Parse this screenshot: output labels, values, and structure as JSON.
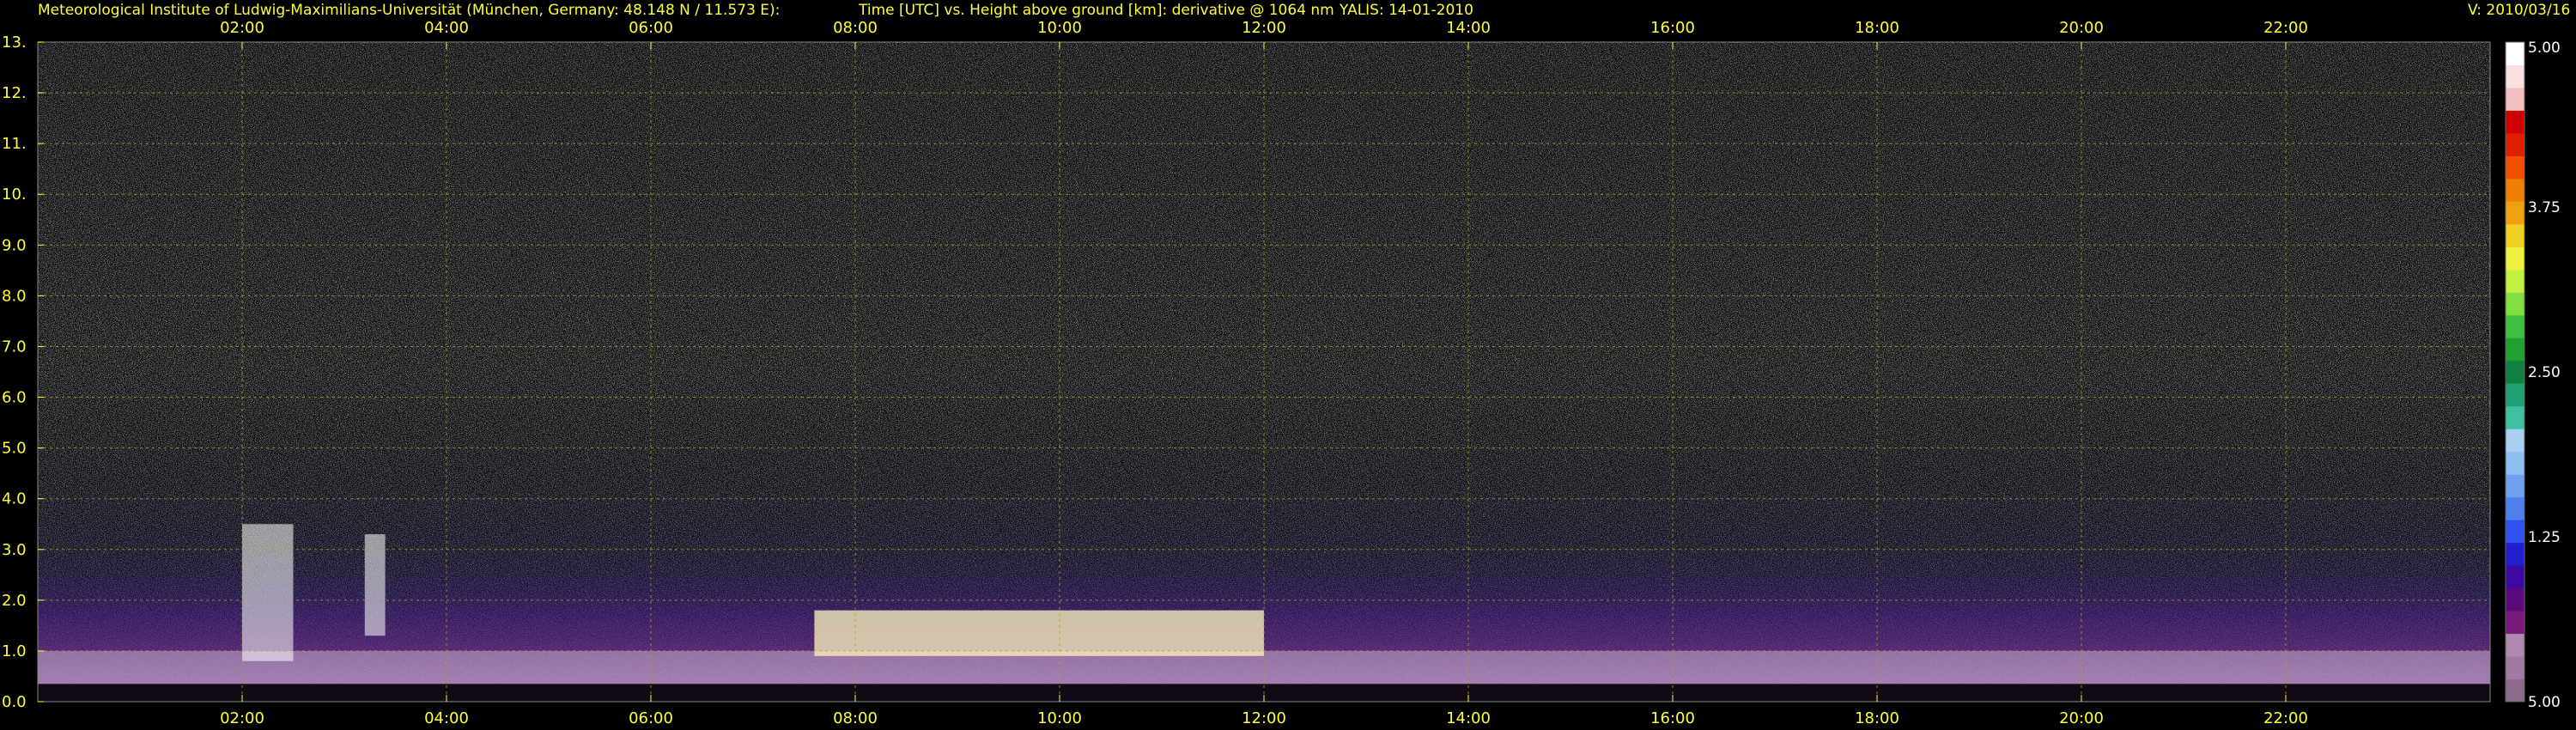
{
  "header": {
    "institute": "Meteorological Institute of Ludwig-Maximilians-Universität (München, Germany: 48.148 N / 11.573 E):",
    "plot_title": "Time [UTC] vs. Height above ground [km]: derivative @ 1064 nm",
    "instrument_date": "YALIS: 14-01-2010",
    "version": "V: 2010/03/16"
  },
  "chart_data": {
    "type": "heatmap",
    "title": "Time [UTC] vs. Height above ground [km]: derivative @ 1064 nm",
    "x_ticks": [
      "02:00",
      "04:00",
      "06:00",
      "08:00",
      "10:00",
      "12:00",
      "14:00",
      "16:00",
      "18:00",
      "20:00",
      "22:00"
    ],
    "x_tick_hours": [
      2,
      4,
      6,
      8,
      10,
      12,
      14,
      16,
      18,
      20,
      22
    ],
    "xlim_hours": [
      0,
      24
    ],
    "y_ticks": [
      "0.0",
      "1.0",
      "2.0",
      "3.0",
      "4.0",
      "5.0",
      "6.0",
      "7.0",
      "8.0",
      "9.0",
      "10.",
      "11.",
      "12.",
      "13."
    ],
    "y_tick_values": [
      0,
      1,
      2,
      3,
      4,
      5,
      6,
      7,
      8,
      9,
      10,
      11,
      12,
      13
    ],
    "ylim_km": [
      0,
      13
    ],
    "grid": true,
    "colorbar": {
      "tick_labels": [
        "5.00",
        "3.75",
        "2.50",
        "1.25",
        "5.00"
      ],
      "tick_values": [
        5.0,
        3.75,
        2.5,
        1.25,
        0
      ],
      "range": [
        0,
        5.0
      ],
      "colors": [
        "#8c6b8c",
        "#a07aa0",
        "#b088b0",
        "#7a1a7a",
        "#5a0a7a",
        "#3c0aa0",
        "#2020d0",
        "#3050f0",
        "#5080f0",
        "#70a0f0",
        "#90c0f0",
        "#a8d0f0",
        "#40c0a0",
        "#20a070",
        "#108040",
        "#20a030",
        "#40c040",
        "#80e040",
        "#c0f040",
        "#f0f040",
        "#f0d020",
        "#f0a010",
        "#f08000",
        "#f05000",
        "#e02000",
        "#d00000",
        "#f0c0c0",
        "#f8e0e0",
        "#ffffff"
      ]
    },
    "features": [
      {
        "label": "boundary layer aerosol",
        "start_hour": 0,
        "end_hour": 24,
        "top_km": 1.0
      },
      {
        "label": "cloud feature",
        "start_hour": 2.0,
        "end_hour": 2.5,
        "base_km": 0.8,
        "top_km": 3.5
      },
      {
        "label": "cloud feature",
        "start_hour": 3.2,
        "end_hour": 3.4,
        "base_km": 1.3,
        "top_km": 3.3
      },
      {
        "label": "bright layer",
        "start_hour": 7.6,
        "end_hour": 12.0,
        "base_km": 0.9,
        "top_km": 1.8
      }
    ]
  }
}
